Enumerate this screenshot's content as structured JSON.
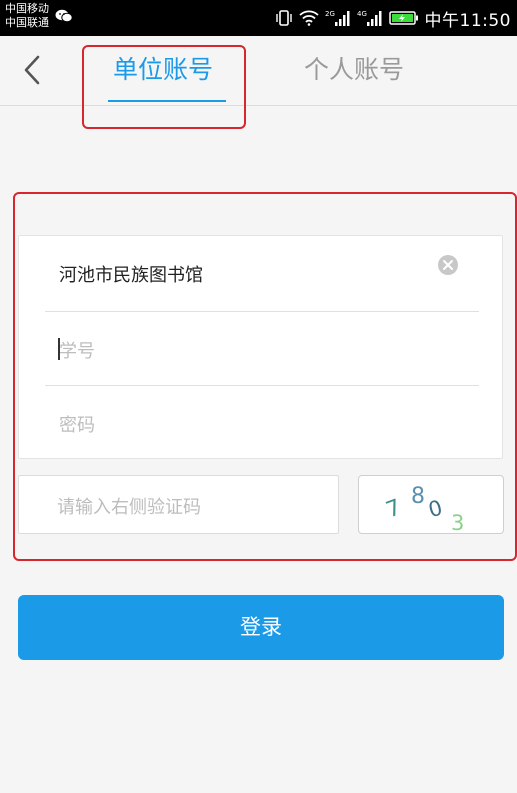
{
  "status_bar": {
    "carrier_1": "中国移动",
    "carrier_2": "中国联通",
    "network_1": "2G",
    "network_2": "4G",
    "time": "中午11:50",
    "icons": [
      "wechat-icon",
      "vibrate-icon",
      "wifi-icon",
      "signal-icon",
      "battery-icon"
    ]
  },
  "header": {
    "back_icon": "chevron-left-icon",
    "tabs": [
      {
        "label": "单位账号",
        "active": true
      },
      {
        "label": "个人账号",
        "active": false
      }
    ]
  },
  "form": {
    "institution": "河池市民族图书馆",
    "student_id_placeholder": "学号",
    "password_placeholder": "密码",
    "captcha_placeholder": "请输入右侧验证码",
    "captcha_text": "7803",
    "clear_icon": "clear-icon"
  },
  "login_button": "登录",
  "colors": {
    "accent": "#1b9ae8",
    "annotation": "#d6262e",
    "background": "#f5f5f5"
  }
}
